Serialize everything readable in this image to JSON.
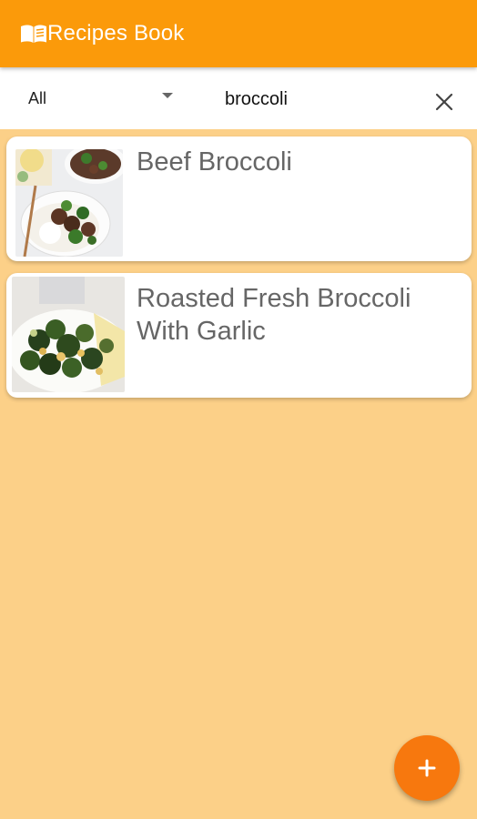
{
  "app_bar": {
    "title": "Recipes Book",
    "icon": "open-book-icon",
    "color": "#FB9A0A"
  },
  "filters": {
    "category": "All",
    "search_value": "broccoli",
    "clear_icon": "close-icon"
  },
  "recipes": [
    {
      "title": "Beef Broccoli",
      "image": "beef-broccoli-photo"
    },
    {
      "title": "Roasted Fresh Broccoli With Garlic",
      "image": "roasted-broccoli-photo"
    }
  ],
  "fab": {
    "icon": "plus-icon",
    "color": "#F7780E"
  },
  "background_color": "#FCD088"
}
